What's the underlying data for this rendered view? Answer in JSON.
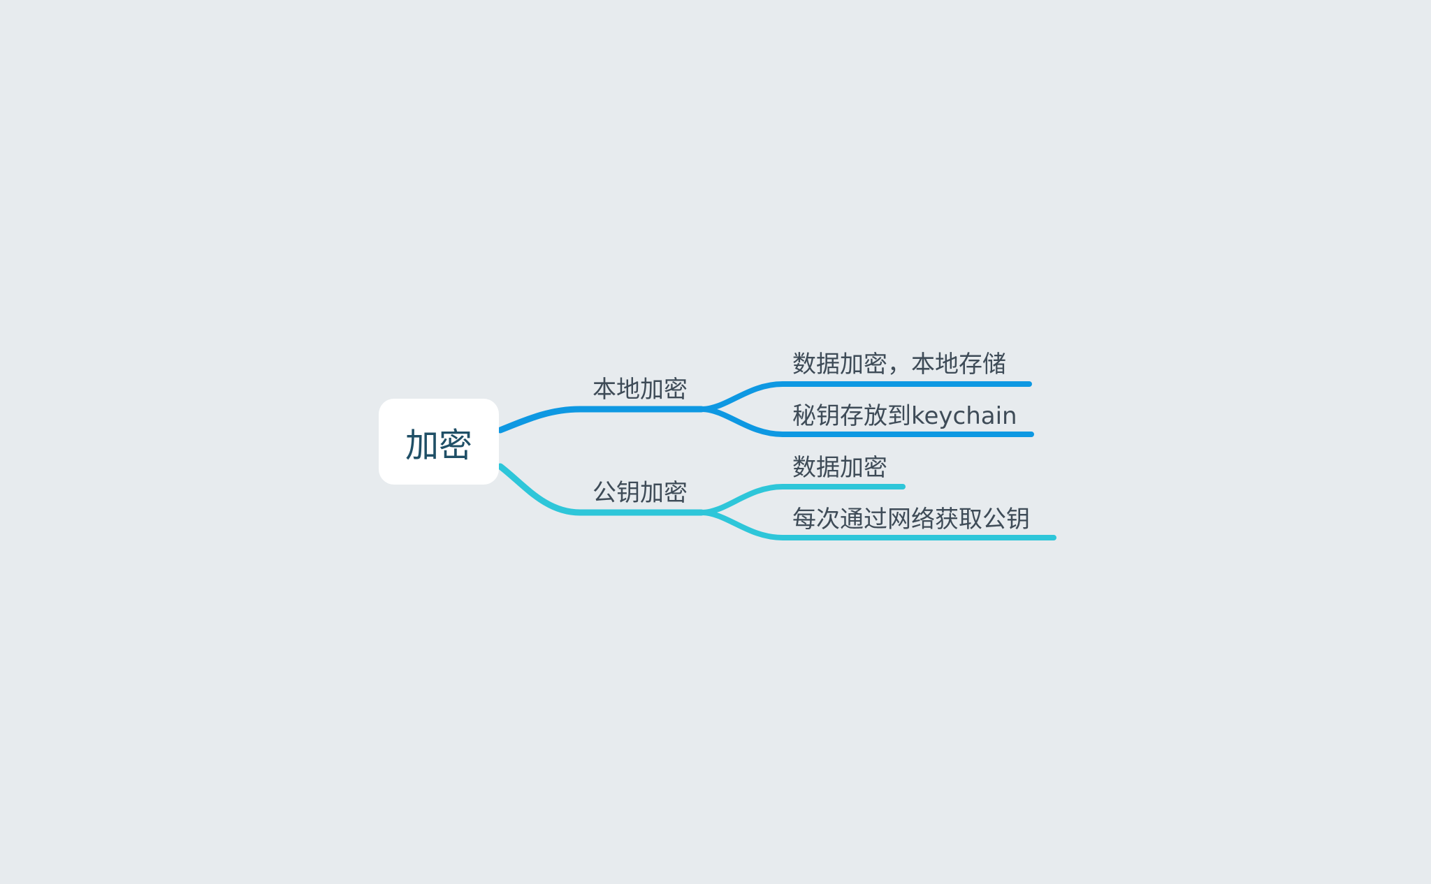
{
  "root": {
    "label": "加密"
  },
  "branches": [
    {
      "label": "本地加密",
      "color": "#0e98e2",
      "children": [
        {
          "label": "数据加密，本地存储"
        },
        {
          "label": "秘钥存放到keychain"
        }
      ]
    },
    {
      "label": "公钥加密",
      "color": "#2ec6d9",
      "children": [
        {
          "label": "数据加密"
        },
        {
          "label": "每次通过网络获取公钥"
        }
      ]
    }
  ]
}
